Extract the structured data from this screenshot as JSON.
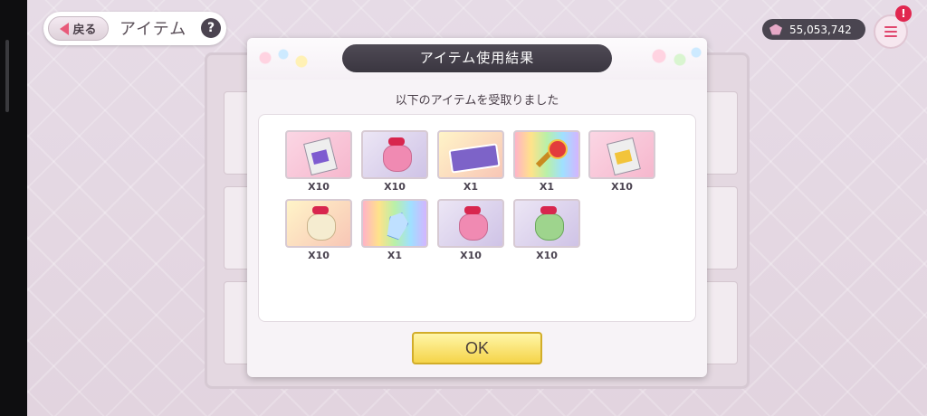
{
  "header": {
    "back_label": "戻る",
    "title": "アイテム",
    "help_label": "?"
  },
  "currency": {
    "amount": "55,053,742",
    "icon": "gem-icon"
  },
  "menu": {
    "icon": "menu-icon",
    "badge": "!"
  },
  "dialog": {
    "title": "アイテム使用結果",
    "subtitle": "以下のアイテムを受取りました",
    "ok_label": "OK",
    "items": [
      {
        "name": "purple-book",
        "quantity": "X10"
      },
      {
        "name": "pink-bag",
        "quantity": "X10"
      },
      {
        "name": "ticket",
        "quantity": "X1"
      },
      {
        "name": "magic-wand",
        "quantity": "X1"
      },
      {
        "name": "gold-book",
        "quantity": "X10"
      },
      {
        "name": "cream-bag",
        "quantity": "X10"
      },
      {
        "name": "crystal",
        "quantity": "X1"
      },
      {
        "name": "pink-bag-2",
        "quantity": "X10"
      },
      {
        "name": "green-bag",
        "quantity": "X10"
      }
    ]
  },
  "colors": {
    "accent": "#e85a7a",
    "dialog_title_bg": "#3f3a46",
    "ok_button": "#f5d44a"
  }
}
